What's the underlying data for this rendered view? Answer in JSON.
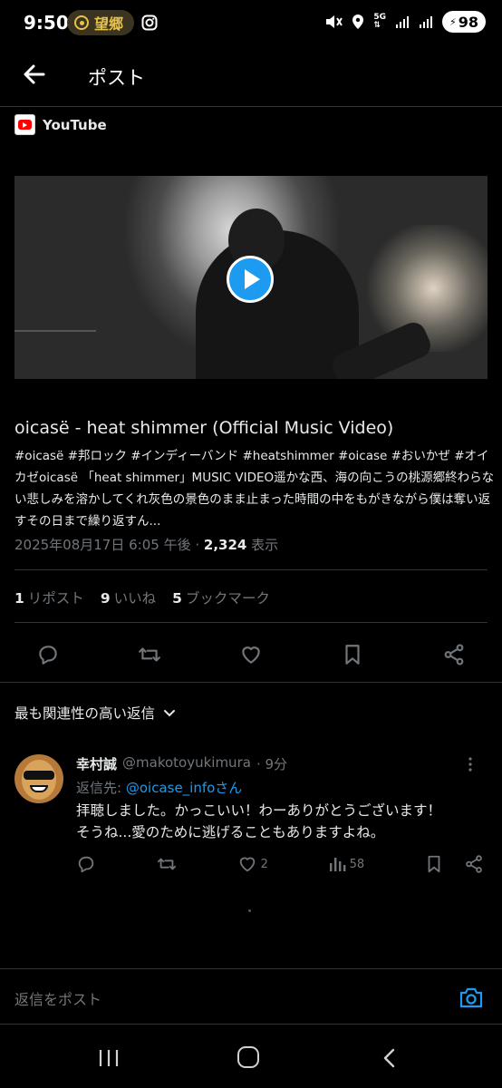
{
  "status_bar": {
    "time": "9:50",
    "notification_label": "望郷",
    "battery": "98",
    "network": "5G"
  },
  "header": {
    "title": "ポスト"
  },
  "card": {
    "source": "YouTube",
    "video_title": "oicasë - heat shimmer (Official Music Video)",
    "description": "#oicasë #邦ロック #インディーバンド #heatshimmer #oicase #おいかぜ #オイカゼoicasë 「heat shimmer」MUSIC VIDEO遥かな西、海の向こうの桃源郷終わらない悲しみを溶かしてくれ灰色の景色のまま止まった時間の中をもがきながら僕は奪い返すその日まで繰り返すん..."
  },
  "meta": {
    "timestamp": "2025年08月17日 6:05 午後",
    "separator": "·",
    "views": "2,324",
    "views_label": "表示"
  },
  "stats": {
    "reposts_count": "1",
    "reposts_label": "リポスト",
    "likes_count": "9",
    "likes_label": "いいね",
    "bookmarks_count": "5",
    "bookmarks_label": "ブックマーク"
  },
  "sort": {
    "label": "最も関連性の高い返信"
  },
  "reply": {
    "name": "幸村誠",
    "handle": "@makotoyukimura",
    "time": "· 9分",
    "reply_to_label": "返信先:",
    "reply_to_handle": "@oicase_infoさん",
    "line1": "拝聴しました。かっこいい！わーありがとうございます！",
    "line2": "そうね...愛のために逃げることもありますよね。",
    "likes": "2",
    "views": "58"
  },
  "composer": {
    "placeholder": "返信をポスト"
  },
  "colors": {
    "accent": "#1d9bf0",
    "background": "#000000",
    "muted_text": "#71767b"
  }
}
